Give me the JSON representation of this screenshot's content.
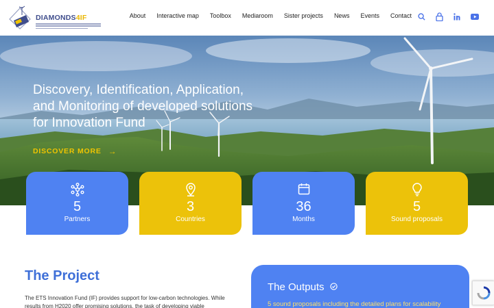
{
  "header": {
    "logo_main": "DIAMONDS",
    "logo_accent": "4IF",
    "nav": [
      "About",
      "Interactive map",
      "Toolbox",
      "Mediaroom",
      "Sister projects",
      "News",
      "Events",
      "Contact"
    ],
    "icons": [
      "search-icon",
      "lock-icon",
      "linkedin-icon",
      "youtube-icon"
    ]
  },
  "hero": {
    "title_lines": [
      "Discovery, Identification, Application,",
      "and Monitoring of developed solutions",
      "for Innovation Fund"
    ],
    "cta": "DISCOVER MORE"
  },
  "stats": [
    {
      "value": "5",
      "label": "Partners",
      "icon": "network-icon",
      "color": "#4f82f2"
    },
    {
      "value": "3",
      "label": "Countries",
      "icon": "location-pin-icon",
      "color": "#ecc20a"
    },
    {
      "value": "36",
      "label": "Months",
      "icon": "calendar-icon",
      "color": "#4f82f2"
    },
    {
      "value": "5",
      "label": "Sound proposals",
      "icon": "lightbulb-icon",
      "color": "#ecc20a"
    }
  ],
  "project": {
    "title": "The Project",
    "text": "The ETS Innovation Fund (IF) provides support for low-carbon technologies. While results from H2020 offer promising solutions, the task of developing viable"
  },
  "outputs": {
    "title": "The Outputs",
    "text": "5 sound proposals including the detailed plans for scalability"
  },
  "colors": {
    "brand_blue": "#4f82f2",
    "brand_yellow": "#ecc20a",
    "title_blue": "#3f70d8"
  }
}
